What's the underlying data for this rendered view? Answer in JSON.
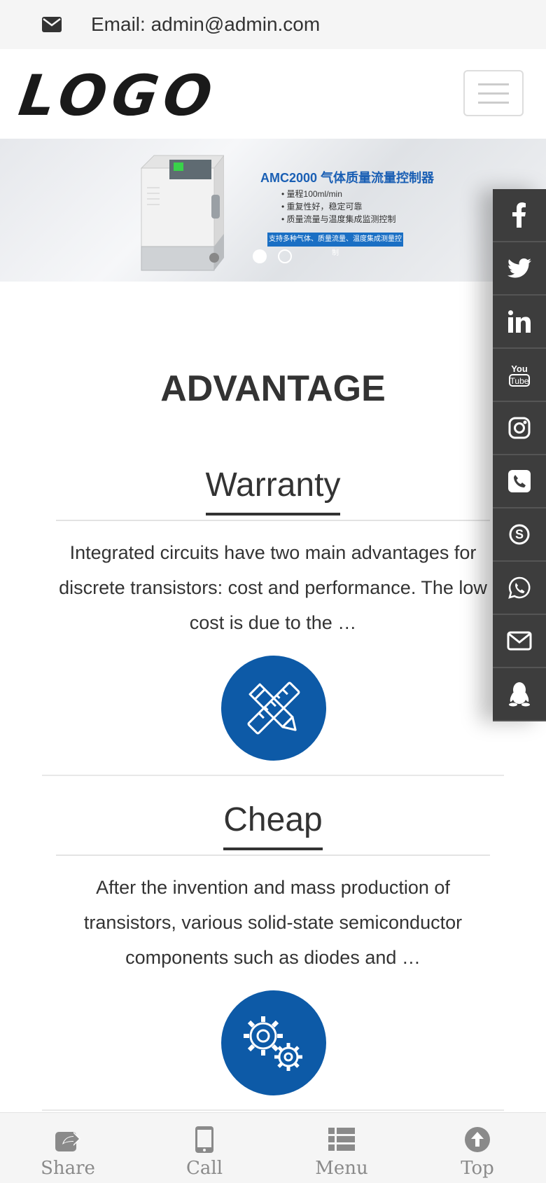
{
  "topbar": {
    "email_text": "Email: admin@admin.com"
  },
  "header": {
    "logo_text": "LOGO"
  },
  "banner": {
    "title": "AMC2000 气体质量流量控制器",
    "lines": [
      "• 量程100ml/min",
      "• 重复性好，稳定可靠",
      "• 质量流量与温度集成监测控制"
    ],
    "cta": "支持多种气体、质量流量、温度集成测量控制",
    "slides": 2,
    "active_slide": 1
  },
  "section": {
    "title": "ADVANTAGE"
  },
  "advantages": [
    {
      "title": "Warranty",
      "text": "Integrated circuits have two main advantages for discrete transistors: cost and performance. The low cost is due to the …",
      "icon": "ruler-pencil-icon"
    },
    {
      "title": "Cheap",
      "text": "After the invention and mass production of transistors, various solid-state semiconductor components such as diodes and …",
      "icon": "gears-icon"
    }
  ],
  "social": [
    "facebook-icon",
    "twitter-icon",
    "linkedin-icon",
    "youtube-icon",
    "instagram-icon",
    "phone-icon",
    "skype-icon",
    "whatsapp-icon",
    "envelope-icon",
    "qq-icon"
  ],
  "bottom_nav": {
    "share": "Share",
    "call": "Call",
    "menu": "Menu",
    "top": "Top"
  },
  "colors": {
    "accent_blue": "#0d5aa7",
    "social_bg": "#3d3d3d"
  }
}
